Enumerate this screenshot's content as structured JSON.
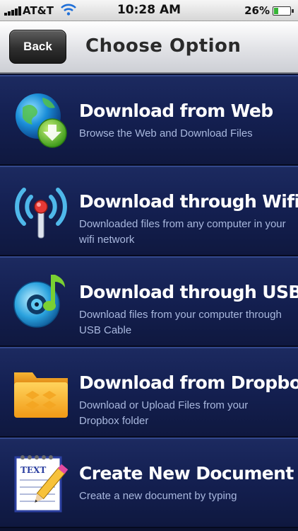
{
  "status_bar": {
    "carrier": "AT&T",
    "time": "10:28 AM",
    "battery": "26%",
    "battery_level": 0.26
  },
  "nav": {
    "back_label": "Back",
    "title": "Choose Option"
  },
  "options": [
    {
      "icon": "globe-download-icon",
      "title": "Download from Web",
      "description": "Browse the Web and Download Files"
    },
    {
      "icon": "wifi-antenna-icon",
      "title": "Download through Wifi",
      "description": "Downloaded files from any computer in your wifi network"
    },
    {
      "icon": "usb-disc-music-icon",
      "title": "Download through USB",
      "description": "Download files from your computer through USB Cable"
    },
    {
      "icon": "dropbox-folder-icon",
      "title": "Download from Dropbox",
      "description": "Download or Upload Files from your Dropbox folder"
    },
    {
      "icon": "text-document-pencil-icon",
      "title": "Create New Document",
      "description": "Create a new document by typing"
    }
  ],
  "colors": {
    "list_background": "#142052",
    "title_text": "#ffffff",
    "description_text": "#a9b8de",
    "battery_fill": "#36b536"
  }
}
